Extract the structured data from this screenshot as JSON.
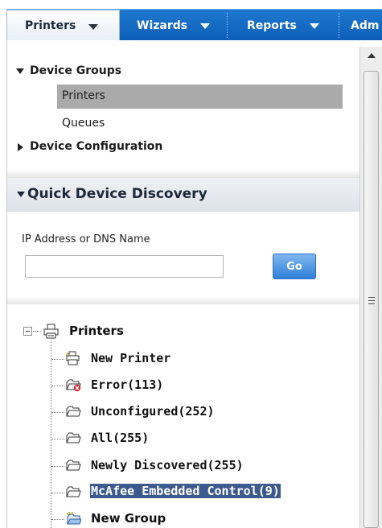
{
  "menubar": {
    "tabs": [
      {
        "label": "Printers"
      },
      {
        "label": "Wizards"
      },
      {
        "label": "Reports"
      },
      {
        "label": "Adm"
      }
    ]
  },
  "device_groups": {
    "header": "Device Groups",
    "items": [
      "Printers",
      "Queues"
    ],
    "selected": "Printers",
    "device_configuration": "Device Configuration"
  },
  "quick_discovery": {
    "title": "Quick Device Discovery",
    "field_label": "IP Address or DNS Name",
    "input_value": "",
    "go_label": "Go"
  },
  "printer_tree": {
    "root": "Printers",
    "items": [
      {
        "label": "New Printer",
        "icon": "new-printer-icon"
      },
      {
        "label": "Error(113)",
        "icon": "error-folder-icon"
      },
      {
        "label": "Unconfigured(252)",
        "icon": "folder-icon"
      },
      {
        "label": "All(255)",
        "icon": "folder-icon"
      },
      {
        "label": "Newly Discovered(255)",
        "icon": "folder-icon"
      },
      {
        "label": "McAfee Embedded Control(9)",
        "icon": "folder-icon",
        "selected": true
      },
      {
        "label": "New Group",
        "icon": "new-group-icon"
      }
    ]
  },
  "colors": {
    "menubar": "#1565c0",
    "selection": "#3d5a8e",
    "go_button": "#2f80d8"
  }
}
